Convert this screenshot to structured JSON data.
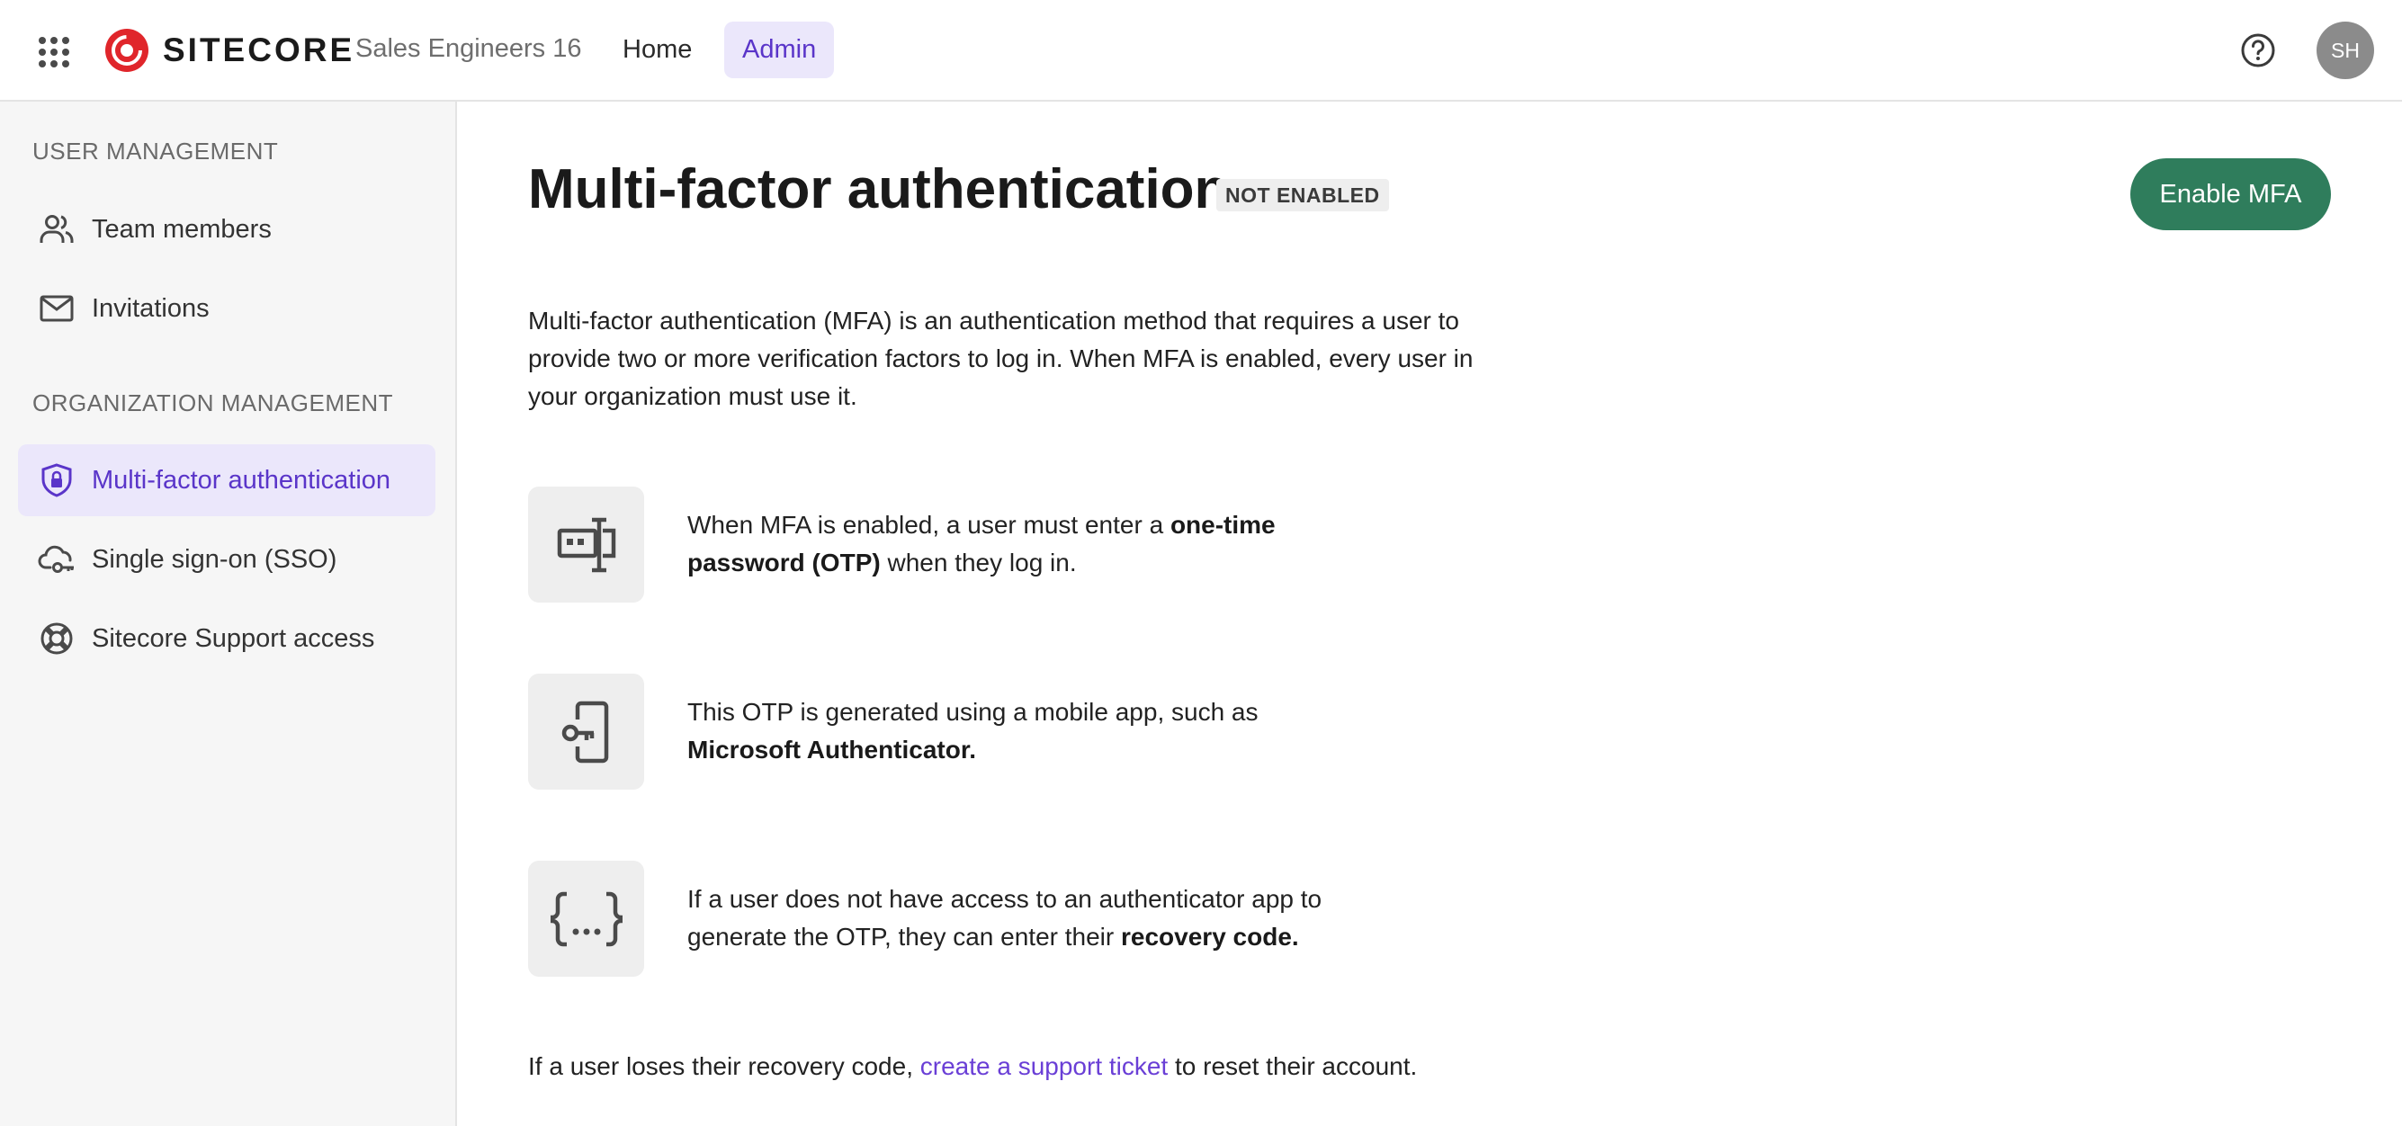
{
  "topbar": {
    "brand": "SITECORE",
    "org_name": "Sales Engineers 16",
    "nav": {
      "home": "Home",
      "admin": "Admin"
    },
    "avatar_initials": "SH",
    "icons": {
      "apps": "grid-apps-icon",
      "help": "help-circle-icon"
    }
  },
  "sidebar": {
    "user_management_heading": "USER MANAGEMENT",
    "org_management_heading": "ORGANIZATION MANAGEMENT",
    "items": [
      {
        "label": "Team members",
        "icon": "people-icon",
        "active": false
      },
      {
        "label": "Invitations",
        "icon": "envelope-icon",
        "active": false
      },
      {
        "label": "Multi-factor authentication",
        "icon": "shield-lock-icon",
        "active": true
      },
      {
        "label": "Single sign-on (SSO)",
        "icon": "cloud-key-icon",
        "active": false
      },
      {
        "label": "Sitecore Support access",
        "icon": "lifebuoy-icon",
        "active": false
      }
    ]
  },
  "main": {
    "title": "Multi-factor authentication",
    "status": "NOT ENABLED",
    "enable_button": "Enable MFA",
    "intro": "Multi-factor authentication (MFA) is an authentication method that requires a user to provide two or more verification factors to log in. When MFA is enabled, every user in your organization must use it.",
    "features": [
      {
        "icon": "password-field-icon",
        "text_before": "When MFA is enabled, a user must enter a ",
        "bold": "one-time password (OTP)",
        "text_after": " when they log in."
      },
      {
        "icon": "phone-key-icon",
        "text_before": "This OTP is generated using a mobile app, such as ",
        "bold": "Microsoft Authenticator.",
        "text_after": ""
      },
      {
        "icon": "code-braces-icon",
        "text_before": "If a user does not have access to an authenticator app to generate the OTP, they can enter their ",
        "bold": "recovery code.",
        "text_after": ""
      }
    ],
    "footer": {
      "before": "If a user loses their recovery code, ",
      "link": "create a support ticket",
      "after": " to reset their account."
    }
  },
  "colors": {
    "accent": "#5a35c9",
    "accent_bg": "#ebe7fb",
    "primary_button": "#2f7d5c",
    "brand_red": "#e0262b"
  }
}
